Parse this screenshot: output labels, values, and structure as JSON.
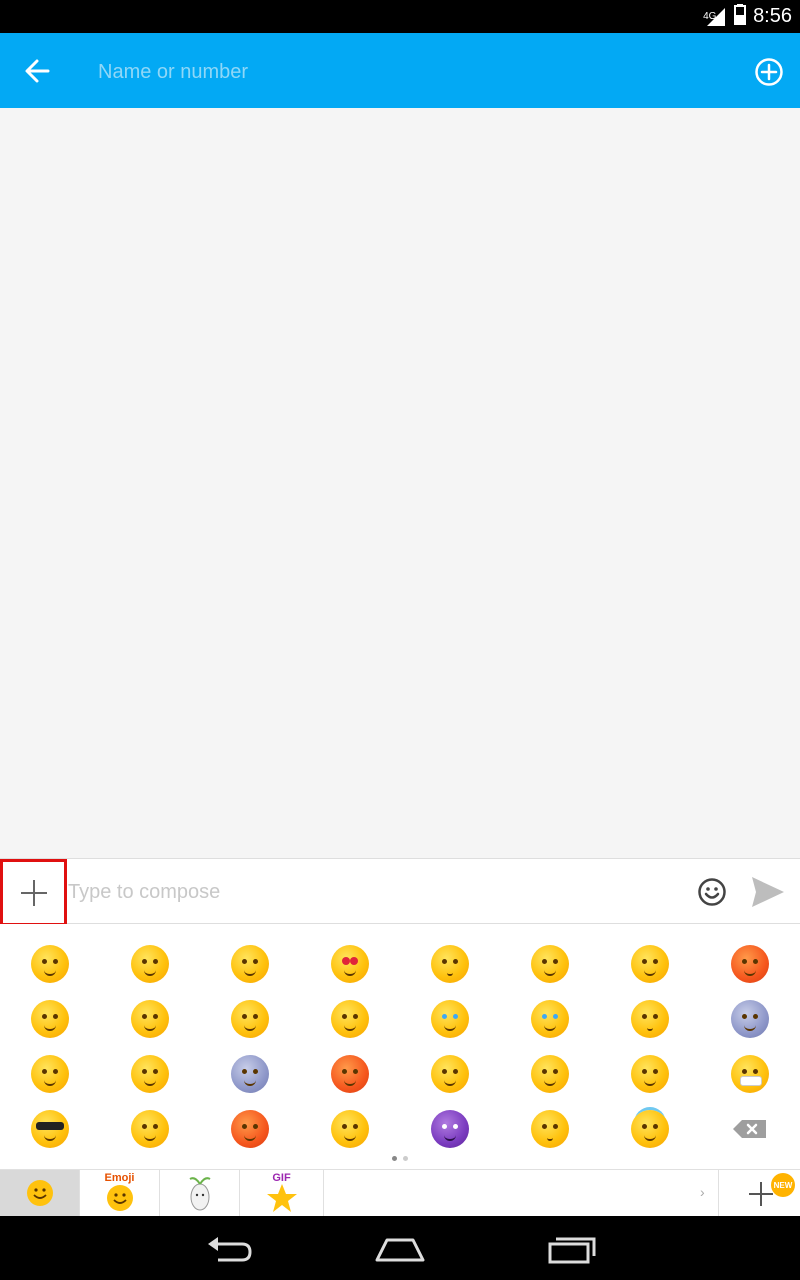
{
  "status_bar": {
    "network": "4G",
    "time": "8:56"
  },
  "app_bar": {
    "recipient_placeholder": "Name or number",
    "back_icon": "arrow-left-icon",
    "add_contact_icon": "plus-circle-icon",
    "color": "#03a9f4"
  },
  "compose": {
    "placeholder": "Type to compose",
    "attach_icon": "plus-icon",
    "emoji_icon": "smiley-icon",
    "send_icon": "send-icon",
    "highlight_color": "#e01010"
  },
  "emoji_panel": {
    "rows": [
      [
        "smile",
        "blush",
        "grin",
        "heart-eyes",
        "kiss",
        "tongue",
        "squint-tongue",
        "flushed"
      ],
      [
        "grimace",
        "relieved",
        "starry",
        "pensive",
        "sob",
        "joy",
        "hushed",
        "fearful"
      ],
      [
        "sweat",
        "persevere",
        "scream",
        "angry",
        "unamused",
        "laugh",
        "smirk",
        "mask"
      ],
      [
        "sunglasses",
        "sleepy",
        "blush-red",
        "tired",
        "imp",
        "neutral",
        "innocent",
        "backspace"
      ]
    ],
    "pages": 2,
    "current_page": 1
  },
  "tab_strip": {
    "tabs": [
      {
        "name": "smiley",
        "label": ""
      },
      {
        "name": "emoji",
        "label": "Emoji"
      },
      {
        "name": "sticker",
        "label": ""
      },
      {
        "name": "gif",
        "label": "GIF"
      }
    ],
    "new_badge": "NEW"
  },
  "nav_bar": {
    "buttons": [
      "back-icon",
      "home-icon",
      "recents-icon"
    ]
  }
}
